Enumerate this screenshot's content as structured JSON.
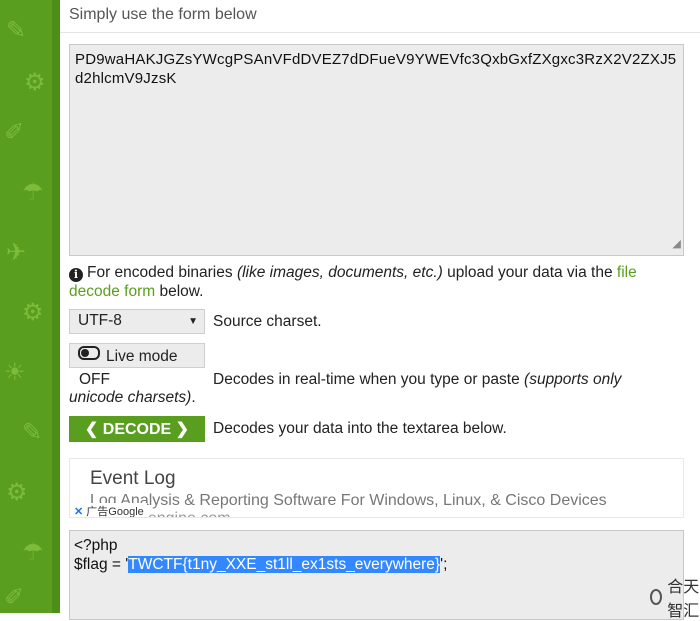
{
  "header": {
    "text": "Simply use the form below"
  },
  "input": {
    "value": "PD9waHAKJGZsYWcgPSAnVFdDVEZ7dDFueV9YWEVfc3QxbGxfZXgxc3RzX2V2ZXJ5d2hlcmV9JzsK"
  },
  "info": {
    "icon": "info-icon",
    "prefix": "For encoded binaries",
    "italic": "(like images, documents, etc.)",
    "middle": "upload your data via the",
    "link": "file decode form",
    "suffix": "below."
  },
  "charset": {
    "selected": "UTF-8",
    "label": "Source charset."
  },
  "live_mode": {
    "button_label": "Live mode",
    "state": "OFF",
    "desc": "Decodes in real-time when you type or paste",
    "desc_italic_1": "(supports only",
    "desc_italic_2": "unicode charsets)",
    "desc_end": "."
  },
  "decode": {
    "button_label": "DECODE",
    "desc": "Decodes your data into the textarea below."
  },
  "ad": {
    "title": "Event Log",
    "text": "Log Analysis & Reporting Software For Windows, Linux, & Cisco Devices",
    "cut_text": "manageengine.com",
    "badge": "广告Google",
    "badge_x": "✕"
  },
  "output": {
    "line1": "<?php",
    "line2_prefix": "$flag = '",
    "flag": "TWCTF{t1ny_XXE_st1ll_ex1sts_everywhere}",
    "line2_suffix": "';"
  },
  "watermark": {
    "text": "合天智汇"
  },
  "colors": {
    "brand_green": "#5a9e1f",
    "selection_blue": "#3388ff"
  }
}
